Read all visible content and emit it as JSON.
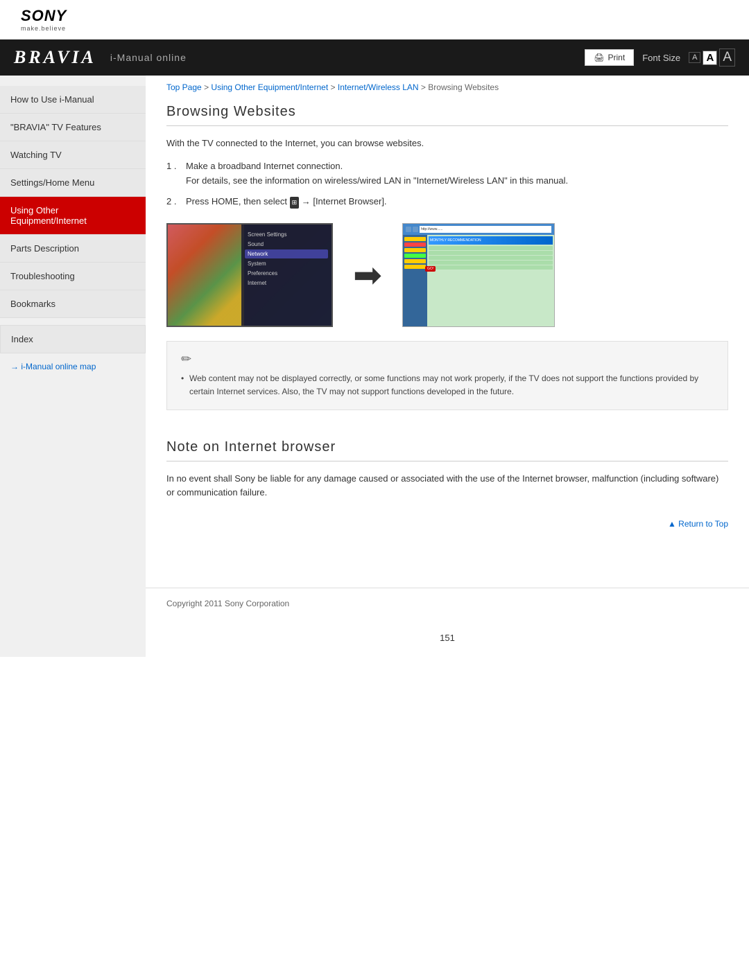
{
  "logo": {
    "brand": "SONY",
    "tagline": "make.believe",
    "product": "BRAVIA",
    "subtitle": "i-Manual online"
  },
  "toolbar": {
    "print_label": "Print",
    "font_size_label": "Font Size",
    "font_small": "A",
    "font_medium": "A",
    "font_large": "A"
  },
  "breadcrumb": {
    "top_page": "Top Page",
    "sep1": " > ",
    "item2": "Using Other Equipment/Internet",
    "sep2": " > ",
    "item3": "Internet/Wireless LAN",
    "sep3": " > ",
    "current": "Browsing Websites"
  },
  "sidebar": {
    "items": [
      {
        "label": "How to Use i-Manual",
        "active": false,
        "id": "how-to-use"
      },
      {
        "label": "\"BRAVIA\" TV Features",
        "active": false,
        "id": "bravia-features"
      },
      {
        "label": "Watching TV",
        "active": false,
        "id": "watching-tv"
      },
      {
        "label": "Settings/Home Menu",
        "active": false,
        "id": "settings-home"
      },
      {
        "label": "Using Other Equipment/Internet",
        "active": true,
        "id": "using-other"
      },
      {
        "label": "Parts Description",
        "active": false,
        "id": "parts-desc"
      },
      {
        "label": "Troubleshooting",
        "active": false,
        "id": "troubleshooting"
      },
      {
        "label": "Bookmarks",
        "active": false,
        "id": "bookmarks"
      }
    ],
    "index_label": "Index",
    "map_label": "i-Manual online map"
  },
  "page": {
    "title": "Browsing Websites",
    "intro": "With the TV connected to the Internet, you can browse websites.",
    "steps": [
      {
        "num": "1 .",
        "text": "Make a broadband Internet connection.",
        "sub": "For details, see the information on wireless/wired LAN in \"Internet/Wireless LAN\" in this manual."
      },
      {
        "num": "2 .",
        "text": "Press HOME, then select  → [Internet Browser]."
      }
    ],
    "note": {
      "icon": "✏",
      "items": [
        "Web content may not be displayed correctly, or some functions may not work properly, if the TV does not support the functions provided by certain Internet services. Also, the TV may not support functions developed in the future."
      ]
    }
  },
  "note_section": {
    "title": "Note on Internet browser",
    "body": "In no event shall Sony be liable for any damage caused or associated with the use of the Internet browser, malfunction (including software) or communication failure."
  },
  "return_to_top": "Return to Top",
  "footer": {
    "copyright": "Copyright 2011 Sony Corporation"
  },
  "page_number": "151",
  "tv_menu_items": [
    {
      "label": "Screen Settings",
      "selected": false
    },
    {
      "label": "Sound",
      "selected": false
    },
    {
      "label": "Network",
      "selected": true
    },
    {
      "label": "System",
      "selected": false
    },
    {
      "label": "Preferences",
      "selected": false
    }
  ],
  "browser_url": "http://www......"
}
